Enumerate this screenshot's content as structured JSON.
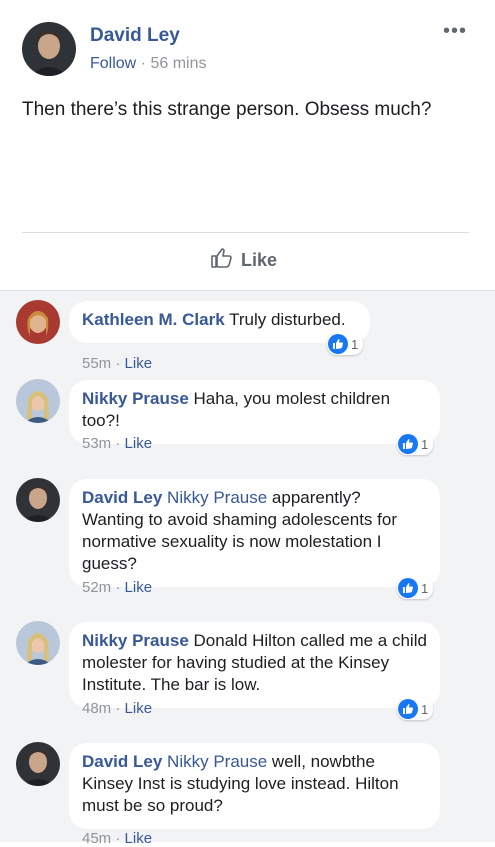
{
  "post": {
    "author": "David Ley",
    "follow": "Follow",
    "separator": " · ",
    "time": "56 mins",
    "more_icon": "•••",
    "text": "Then there’s this strange person. Obsess much?",
    "like_label": "Like"
  },
  "comments": [
    {
      "author": "Kathleen M. Clark",
      "tag": "",
      "text": " Truly disturbed.",
      "time": "55m",
      "like": "Like",
      "reactions": "1",
      "avatar_color": "#c0504d"
    },
    {
      "author": "Nikky Prause",
      "tag": "",
      "text": " Haha, you molest children too?!",
      "time": "53m",
      "like": "Like",
      "reactions": "1",
      "avatar_color": "#8fa8c8"
    },
    {
      "author": "David Ley",
      "tag": " Nikky Prause",
      "text": " apparently? Wanting to avoid shaming adolescents for normative sexuality is now molestation I guess?",
      "time": "52m",
      "like": "Like",
      "reactions": "1",
      "avatar_color": "#3a3f46"
    },
    {
      "author": "Nikky Prause",
      "tag": "",
      "text": " Donald Hilton called me a child molester for having studied at the Kinsey Institute. The bar is low.",
      "time": "48m",
      "like": "Like",
      "reactions": "1",
      "avatar_color": "#8fa8c8"
    },
    {
      "author": "David Ley",
      "tag": " Nikky Prause",
      "text": " well, nowbthe Kinsey Inst is studying love instead. Hilton must be so proud?",
      "time": "45m",
      "like": "Like",
      "reactions": "",
      "avatar_color": "#3a3f46"
    }
  ]
}
